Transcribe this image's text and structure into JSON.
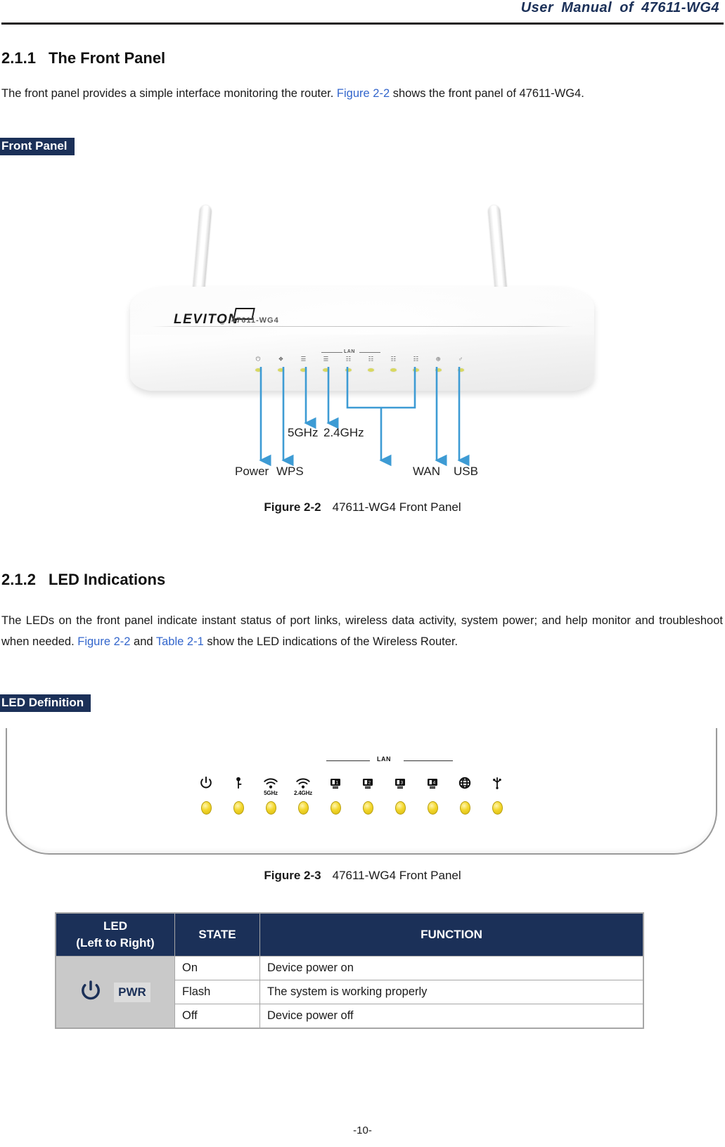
{
  "header": {
    "title": "User Manual of 47611-WG4"
  },
  "sections": {
    "front_panel": {
      "number": "2.1.1",
      "title": "The Front Panel",
      "paragraph_pre": "The front panel provides a simple interface monitoring the router. ",
      "paragraph_link": "Figure 2-2",
      "paragraph_post": " shows the front panel of 47611-WG4.",
      "tag": "Front Panel"
    },
    "led_indications": {
      "number": "2.1.2",
      "title": "LED Indications",
      "paragraph_pre": "The LEDs on the front panel indicate instant status of port links, wireless data activity, system power; and help monitor and troubleshoot when needed. ",
      "paragraph_link1": "Figure 2-2",
      "paragraph_mid": " and ",
      "paragraph_link2": "Table 2-1",
      "paragraph_post": " show the LED indications of the Wireless Router.",
      "tag": "LED Definition"
    }
  },
  "figure_2_2": {
    "label": "Figure 2-2",
    "caption": "47611-WG4 Front Panel",
    "brand": "LEVITON",
    "brand_reg": "®",
    "model": "47611-WG4",
    "lan_group_label": "LAN",
    "callouts": [
      {
        "name": "power",
        "label": "Power"
      },
      {
        "name": "wps",
        "label": "WPS"
      },
      {
        "name": "5ghz",
        "label": "5GHz"
      },
      {
        "name": "24ghz",
        "label": "2.4GHz"
      },
      {
        "name": "lan",
        "label": ""
      },
      {
        "name": "wan",
        "label": "WAN"
      },
      {
        "name": "usb",
        "label": "USB"
      }
    ],
    "callout_color": "#3d9bd4"
  },
  "figure_2_3": {
    "label": "Figure 2-3",
    "caption": "47611-WG4 Front Panel",
    "lan_group_label": "LAN",
    "leds": [
      {
        "name": "power-icon",
        "glyph": "⏻",
        "sub": ""
      },
      {
        "name": "wps-icon",
        "glyph": "•",
        "sub": ""
      },
      {
        "name": "wifi-5ghz-icon",
        "glyph": "ᴵ",
        "sub": "5GHz"
      },
      {
        "name": "wifi-24ghz-icon",
        "glyph": "ᴵ",
        "sub": "2.4GHz"
      },
      {
        "name": "lan1-icon",
        "glyph": "1",
        "sub": ""
      },
      {
        "name": "lan2-icon",
        "glyph": "2",
        "sub": ""
      },
      {
        "name": "lan3-icon",
        "glyph": "3",
        "sub": ""
      },
      {
        "name": "lan4-icon",
        "glyph": "4",
        "sub": ""
      },
      {
        "name": "wan-globe-icon",
        "glyph": "⊕",
        "sub": ""
      },
      {
        "name": "usb-icon",
        "glyph": "⑂",
        "sub": ""
      }
    ]
  },
  "table_2_1": {
    "headers": {
      "led": "LED",
      "led_sub": "(Left to Right)",
      "state": "STATE",
      "function": "FUNCTION"
    },
    "rows": [
      {
        "led_name": "PWR",
        "led_icon": "power-icon",
        "states": [
          {
            "state": "On",
            "function": "Device power on"
          },
          {
            "state": "Flash",
            "function": "The system is working properly"
          },
          {
            "state": "Off",
            "function": "Device power off"
          }
        ]
      }
    ]
  },
  "footer": {
    "page_number": "-10-"
  },
  "colors": {
    "brand_navy": "#1b3058",
    "link_blue": "#3366cc",
    "callout_blue": "#3d9bd4",
    "led_yellow": "#f3d62b",
    "table_gray": "#c9c9c9"
  }
}
